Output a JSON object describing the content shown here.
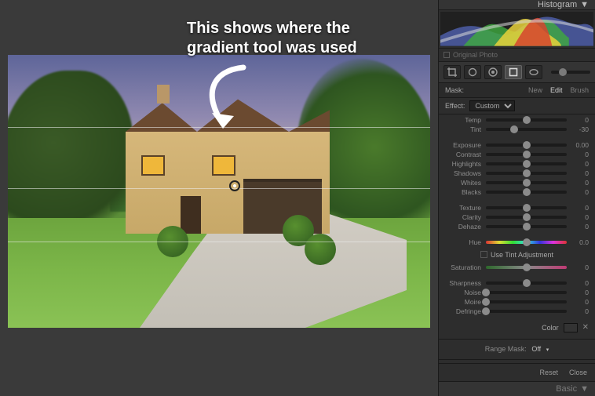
{
  "annotations": {
    "gradient_caption": "This shows where the gradient tool was used",
    "gradient_tool_label": "Gradient Tool"
  },
  "panel": {
    "histogram_label": "Histogram",
    "original_photo_label": "Original Photo",
    "mask_label": "Mask:",
    "tabs": {
      "new": "New",
      "edit": "Edit",
      "brush": "Brush"
    },
    "effect_label": "Effect:",
    "effect_value": "Custom",
    "use_tint_label": "Use Tint Adjustment",
    "color_label": "Color",
    "range_mask_label": "Range Mask:",
    "range_mask_value": "Off",
    "reset_label": "Reset",
    "close_label": "Close",
    "basic_label": "Basic"
  },
  "sliders": {
    "group_tone": [
      {
        "label": "Temp",
        "value": 0,
        "pos": 50
      },
      {
        "label": "Tint",
        "value": -30,
        "pos": 35
      }
    ],
    "group_light": [
      {
        "label": "Exposure",
        "value": "0.00",
        "pos": 50
      },
      {
        "label": "Contrast",
        "value": 0,
        "pos": 50
      },
      {
        "label": "Highlights",
        "value": 0,
        "pos": 50
      },
      {
        "label": "Shadows",
        "value": 0,
        "pos": 50
      },
      {
        "label": "Whites",
        "value": 0,
        "pos": 50
      },
      {
        "label": "Blacks",
        "value": 0,
        "pos": 50
      }
    ],
    "group_presence": [
      {
        "label": "Texture",
        "value": 0,
        "pos": 50
      },
      {
        "label": "Clarity",
        "value": 0,
        "pos": 50
      },
      {
        "label": "Dehaze",
        "value": 0,
        "pos": 50
      }
    ],
    "hue": {
      "label": "Hue",
      "value": "0.0",
      "pos": 50
    },
    "saturation": {
      "label": "Saturation",
      "value": 0,
      "pos": 50
    },
    "group_detail": [
      {
        "label": "Sharpness",
        "value": 0,
        "pos": 50
      },
      {
        "label": "Noise",
        "value": 0,
        "pos": 0
      },
      {
        "label": "Moire",
        "value": 0,
        "pos": 0
      },
      {
        "label": "Defringe",
        "value": 0,
        "pos": 0
      }
    ]
  }
}
